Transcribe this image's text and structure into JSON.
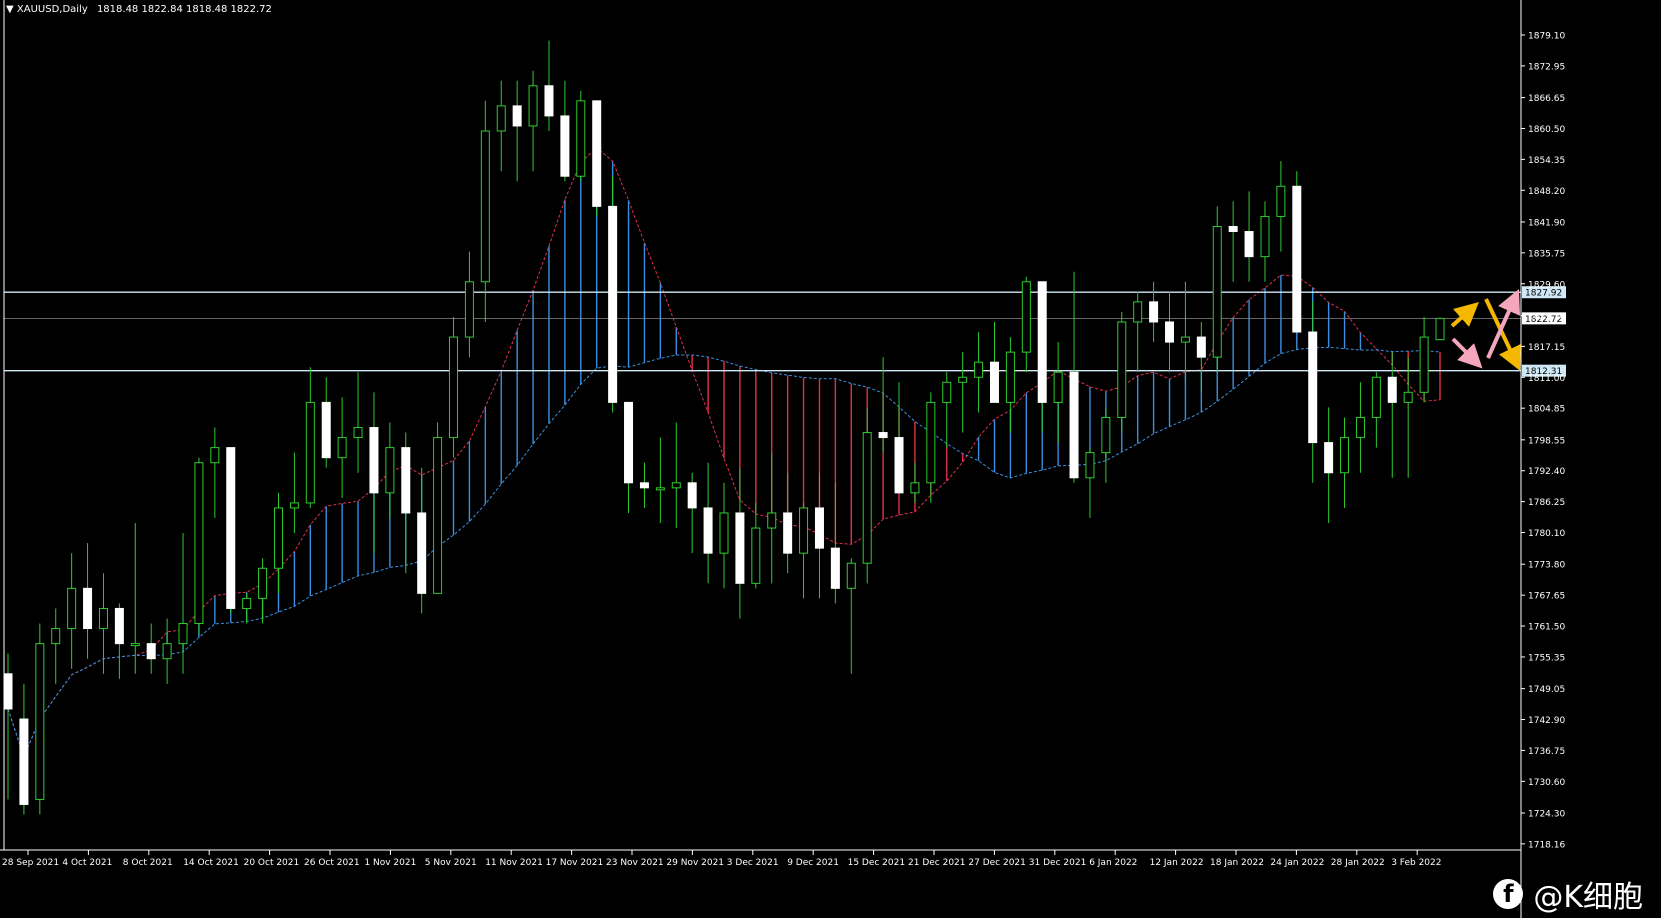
{
  "header": {
    "symbol": "XAUUSD,Daily",
    "ohlc": "1818.48 1822.84 1818.48 1822.72"
  },
  "watermark": {
    "icon": "facebook-icon",
    "text": "@K细胞"
  },
  "colors": {
    "background": "#000000",
    "bull_wick": "#2ecc2e",
    "candle_body": "#ffffff",
    "axis_text": "#ffffff",
    "cloud_up": "#3a8fe0",
    "cloud_down": "#e0304a",
    "level_line": "#cfe8f5",
    "arrow_yellow": "#f5b800",
    "arrow_pink": "#f4a6bd"
  },
  "chart_data": {
    "type": "candlestick",
    "symbol": "XAUUSD",
    "timeframe": "Daily",
    "ylim": [
      1718.16,
      1883.0
    ],
    "y_ticks": [
      1879.1,
      1872.95,
      1866.65,
      1860.5,
      1854.35,
      1848.2,
      1841.9,
      1835.75,
      1829.6,
      1823.3,
      1817.15,
      1811.0,
      1804.85,
      1798.55,
      1792.4,
      1786.25,
      1780.1,
      1773.8,
      1767.65,
      1761.5,
      1755.35,
      1749.05,
      1742.9,
      1736.75,
      1730.6,
      1724.3,
      1718.16
    ],
    "x_labels": [
      "28 Sep 2021",
      "4 Oct 2021",
      "8 Oct 2021",
      "14 Oct 2021",
      "20 Oct 2021",
      "26 Oct 2021",
      "1 Nov 2021",
      "5 Nov 2021",
      "11 Nov 2021",
      "17 Nov 2021",
      "23 Nov 2021",
      "29 Nov 2021",
      "3 Dec 2021",
      "9 Dec 2021",
      "15 Dec 2021",
      "21 Dec 2021",
      "27 Dec 2021",
      "31 Dec 2021",
      "6 Jan 2022",
      "12 Jan 2022",
      "18 Jan 2022",
      "24 Jan 2022",
      "28 Jan 2022",
      "3 Feb 2022"
    ],
    "level_lines": [
      {
        "price": 1827.92,
        "label": "1827.92"
      },
      {
        "price": 1812.31,
        "label": "1812.31"
      }
    ],
    "current_price": {
      "price": 1822.72,
      "label": "1822.72"
    },
    "candles": [
      [
        1752,
        1756,
        1727,
        1745
      ],
      [
        1743,
        1750,
        1724,
        1726
      ],
      [
        1727,
        1762,
        1724,
        1758
      ],
      [
        1758,
        1765,
        1750,
        1761
      ],
      [
        1761,
        1776,
        1753,
        1769
      ],
      [
        1769,
        1778,
        1755,
        1761
      ],
      [
        1761,
        1772,
        1752,
        1765
      ],
      [
        1765,
        1766,
        1751,
        1758
      ],
      [
        1758,
        1782,
        1752,
        1758
      ],
      [
        1758,
        1762,
        1752,
        1755
      ],
      [
        1755,
        1763,
        1750,
        1758
      ],
      [
        1758,
        1780,
        1752,
        1762
      ],
      [
        1762,
        1795,
        1760,
        1794
      ],
      [
        1794,
        1801,
        1783,
        1797
      ],
      [
        1797,
        1797,
        1764,
        1765
      ],
      [
        1765,
        1768,
        1762,
        1767
      ],
      [
        1767,
        1775,
        1762,
        1773
      ],
      [
        1773,
        1788,
        1768,
        1785
      ],
      [
        1785,
        1796,
        1780,
        1786
      ],
      [
        1786,
        1813,
        1785,
        1806
      ],
      [
        1806,
        1811,
        1793,
        1795
      ],
      [
        1795,
        1807,
        1787,
        1799
      ],
      [
        1799,
        1812,
        1792,
        1801
      ],
      [
        1801,
        1808,
        1776,
        1788
      ],
      [
        1788,
        1802,
        1783,
        1797
      ],
      [
        1797,
        1800,
        1772,
        1784
      ],
      [
        1784,
        1793,
        1764,
        1768
      ],
      [
        1768,
        1802,
        1768,
        1799
      ],
      [
        1799,
        1823,
        1795,
        1819
      ],
      [
        1819,
        1836,
        1815,
        1830
      ],
      [
        1830,
        1866,
        1822,
        1860
      ],
      [
        1860,
        1870,
        1852,
        1865
      ],
      [
        1865,
        1870,
        1850,
        1861
      ],
      [
        1861,
        1872,
        1852,
        1869
      ],
      [
        1869,
        1878,
        1860,
        1863
      ],
      [
        1863,
        1870,
        1850,
        1851
      ],
      [
        1851,
        1868,
        1850,
        1866
      ],
      [
        1866,
        1866,
        1843,
        1845
      ],
      [
        1845,
        1851,
        1804,
        1806
      ],
      [
        1806,
        1806,
        1784,
        1790
      ],
      [
        1790,
        1794,
        1785,
        1789
      ],
      [
        1789,
        1799,
        1782,
        1789
      ],
      [
        1789,
        1802,
        1781,
        1790
      ],
      [
        1790,
        1792,
        1776,
        1785
      ],
      [
        1785,
        1794,
        1770,
        1776
      ],
      [
        1776,
        1790,
        1769,
        1784
      ],
      [
        1784,
        1793,
        1763,
        1770
      ],
      [
        1770,
        1786,
        1769,
        1781
      ],
      [
        1781,
        1796,
        1770,
        1784
      ],
      [
        1784,
        1792,
        1772,
        1776
      ],
      [
        1776,
        1786,
        1767,
        1785
      ],
      [
        1785,
        1792,
        1767,
        1777
      ],
      [
        1777,
        1790,
        1766,
        1769
      ],
      [
        1769,
        1775,
        1752,
        1774
      ],
      [
        1774,
        1805,
        1770,
        1800
      ],
      [
        1800,
        1815,
        1796,
        1799
      ],
      [
        1799,
        1810,
        1790,
        1788
      ],
      [
        1788,
        1794,
        1786,
        1790
      ],
      [
        1790,
        1808,
        1786,
        1806
      ],
      [
        1806,
        1812,
        1797,
        1810
      ],
      [
        1810,
        1816,
        1800,
        1811
      ],
      [
        1811,
        1820,
        1804,
        1814
      ],
      [
        1814,
        1822,
        1806,
        1806
      ],
      [
        1806,
        1819,
        1800,
        1816
      ],
      [
        1816,
        1831,
        1812,
        1830
      ],
      [
        1830,
        1830,
        1800,
        1806
      ],
      [
        1806,
        1818,
        1798,
        1812
      ],
      [
        1812,
        1832,
        1790,
        1791
      ],
      [
        1791,
        1797,
        1783,
        1796
      ],
      [
        1796,
        1805,
        1790,
        1803
      ],
      [
        1803,
        1824,
        1800,
        1822
      ],
      [
        1822,
        1828,
        1812,
        1826
      ],
      [
        1826,
        1830,
        1818,
        1822
      ],
      [
        1822,
        1828,
        1812,
        1818
      ],
      [
        1818,
        1830,
        1810,
        1819
      ],
      [
        1819,
        1822,
        1808,
        1815
      ],
      [
        1815,
        1845,
        1812,
        1841
      ],
      [
        1841,
        1846,
        1830,
        1840
      ],
      [
        1840,
        1848,
        1830,
        1835
      ],
      [
        1835,
        1846,
        1830,
        1843
      ],
      [
        1843,
        1854,
        1836,
        1849
      ],
      [
        1849,
        1852,
        1820,
        1820
      ],
      [
        1820,
        1826,
        1790,
        1798
      ],
      [
        1798,
        1805,
        1782,
        1792
      ],
      [
        1792,
        1803,
        1785,
        1799
      ],
      [
        1799,
        1810,
        1792,
        1803
      ],
      [
        1803,
        1812,
        1797,
        1811
      ],
      [
        1811,
        1816,
        1791,
        1806
      ],
      [
        1806,
        1815,
        1791,
        1808
      ],
      [
        1808,
        1823,
        1806,
        1819
      ],
      [
        1818.48,
        1822.84,
        1818.48,
        1822.72
      ]
    ]
  }
}
